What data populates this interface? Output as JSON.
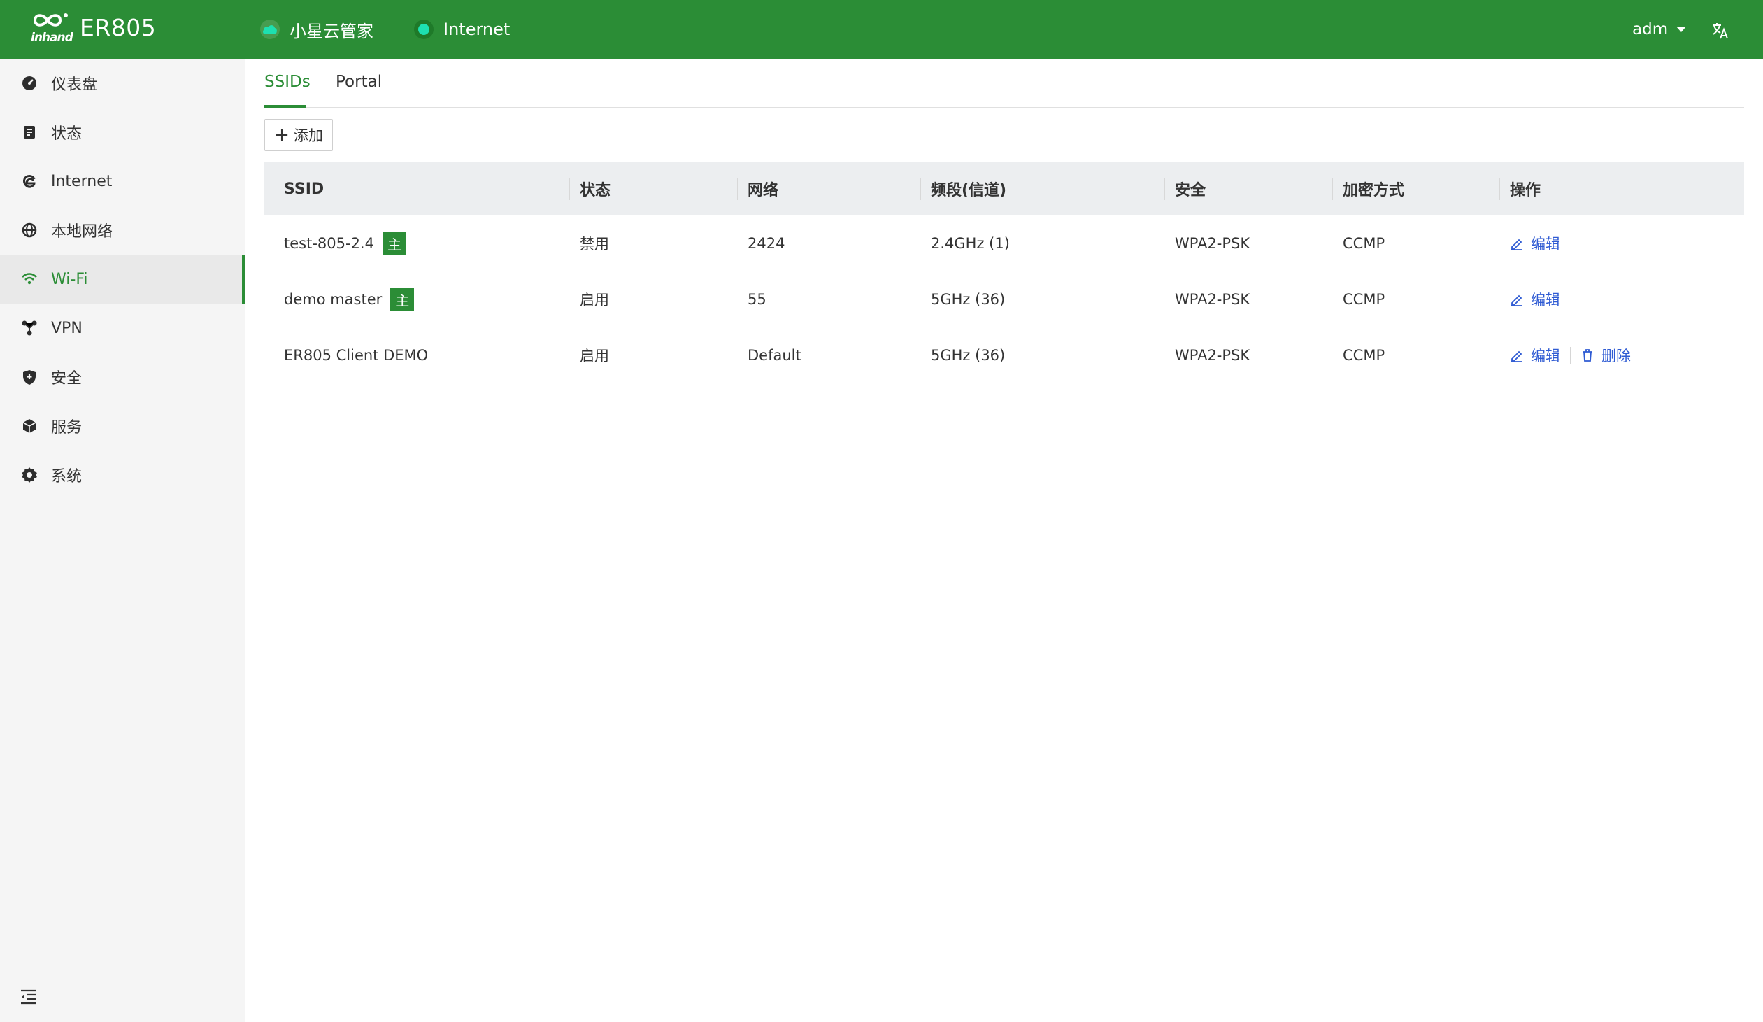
{
  "header": {
    "brand": "inhand",
    "model": "ER805",
    "cloud_label": "小星云管家",
    "internet_label": "Internet",
    "user": "adm",
    "colors": {
      "primary": "#2b8d36",
      "internet_dot": "#1de0b0",
      "link": "#2f5bd3"
    }
  },
  "sidebar": {
    "items": [
      {
        "label": "仪表盘",
        "icon": "dashboard-icon"
      },
      {
        "label": "状态",
        "icon": "document-icon"
      },
      {
        "label": "Internet",
        "icon": "internet-icon"
      },
      {
        "label": "本地网络",
        "icon": "globe-icon"
      },
      {
        "label": "Wi-Fi",
        "icon": "wifi-icon",
        "active": true
      },
      {
        "label": "VPN",
        "icon": "vpn-icon"
      },
      {
        "label": "安全",
        "icon": "shield-icon"
      },
      {
        "label": "服务",
        "icon": "cube-icon"
      },
      {
        "label": "系统",
        "icon": "gear-icon"
      }
    ]
  },
  "tabs": [
    {
      "label": "SSIDs",
      "active": true
    },
    {
      "label": "Portal",
      "active": false
    }
  ],
  "toolbar": {
    "add_label": "添加"
  },
  "table": {
    "headers": [
      "SSID",
      "状态",
      "网络",
      "频段(信道)",
      "安全",
      "加密方式",
      "操作"
    ],
    "rows": [
      {
        "ssid": "test-805-2.4",
        "badge": "主",
        "status": "禁用",
        "network": "2424",
        "band": "2.4GHz (1)",
        "security": "WPA2-PSK",
        "encryption": "CCMP",
        "edit": "编辑"
      },
      {
        "ssid": "demo master",
        "badge": "主",
        "status": "启用",
        "network": "55",
        "band": "5GHz (36)",
        "security": "WPA2-PSK",
        "encryption": "CCMP",
        "edit": "编辑"
      },
      {
        "ssid": "ER805 Client DEMO",
        "status": "启用",
        "network": "Default",
        "band": "5GHz (36)",
        "security": "WPA2-PSK",
        "encryption": "CCMP",
        "edit": "编辑",
        "delete": "删除"
      }
    ]
  }
}
